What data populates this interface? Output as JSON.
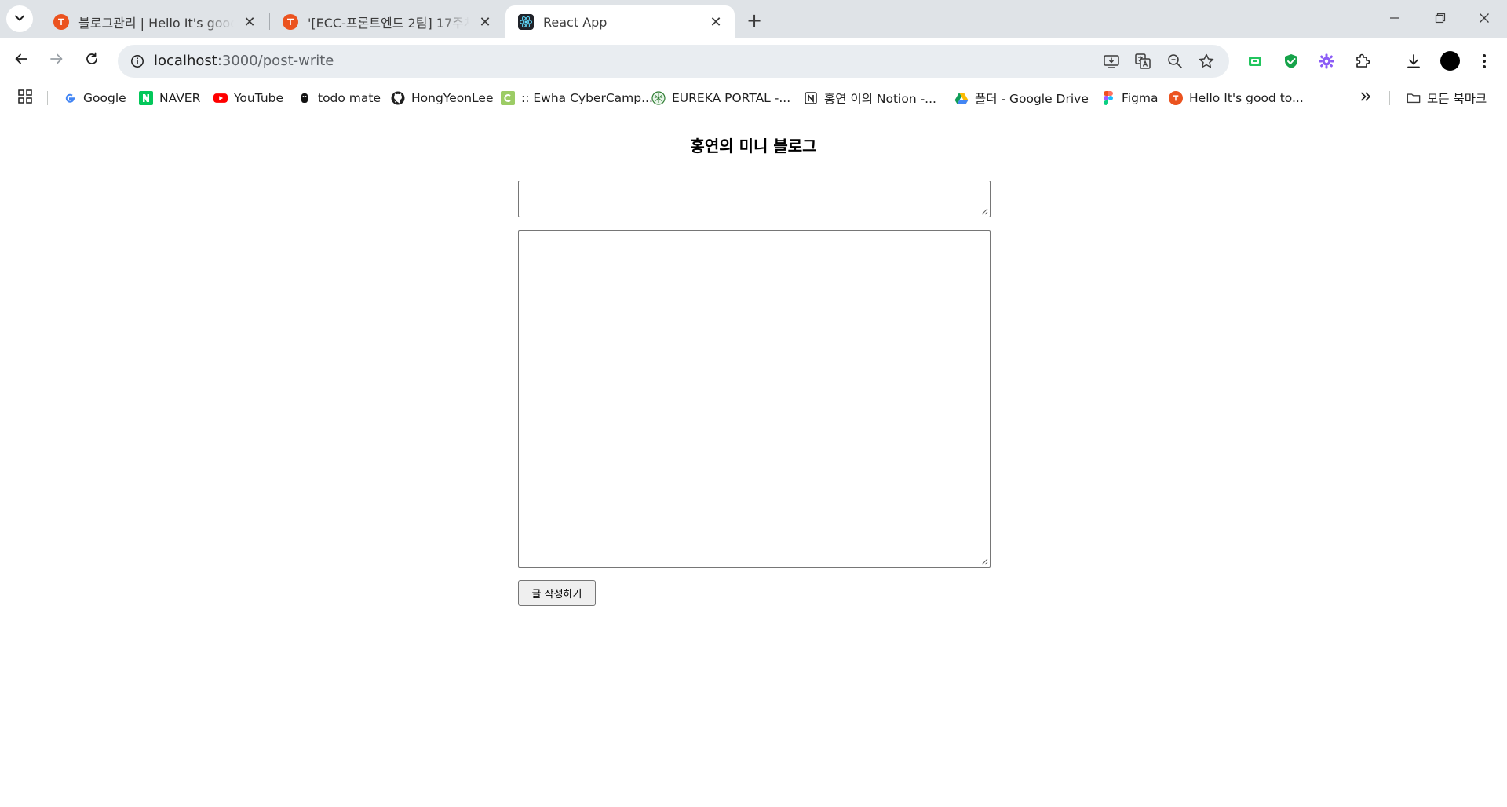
{
  "browser": {
    "tabs": [
      {
        "title": "블로그관리 | Hello It's good to",
        "favicon": "tistory-icon",
        "active": false
      },
      {
        "title": "'[ECC-프론트엔드 2팀] 17주차",
        "favicon": "tistory-icon",
        "active": false
      },
      {
        "title": "React App",
        "favicon": "react-icon",
        "active": true
      }
    ],
    "close_glyph": "✕",
    "new_tab_glyph": "+",
    "address": {
      "host": "localhost",
      "path": ":3000/post-write"
    },
    "bookmarks": [
      {
        "label": "Google",
        "icon": "google-icon"
      },
      {
        "label": "NAVER",
        "icon": "naver-icon"
      },
      {
        "label": "YouTube",
        "icon": "youtube-icon"
      },
      {
        "label": "todo mate",
        "icon": "todomate-icon"
      },
      {
        "label": "HongYeonLee",
        "icon": "github-icon"
      },
      {
        "label": ":: Ewha CyberCamp...",
        "icon": "cybercampus-icon"
      },
      {
        "label": "EUREKA PORTAL -...",
        "icon": "eureka-icon"
      },
      {
        "label": "홍연 이의 Notion -...",
        "icon": "notion-icon"
      },
      {
        "label": "폴더 - Google Drive",
        "icon": "google-drive-icon"
      },
      {
        "label": "Figma",
        "icon": "figma-icon"
      },
      {
        "label": "Hello It's good to...",
        "icon": "tistory-icon"
      }
    ],
    "all_bookmarks_label": "모든 북마크",
    "colors": {
      "tab_strip": "#dfe3e7",
      "omnibox": "#e9edf1",
      "tistory": "#eb531f",
      "react": "#61dafb"
    }
  },
  "page": {
    "title": "홍연의 미니 블로그",
    "title_input_value": "",
    "content_input_value": "",
    "submit_label": "글 작성하기"
  }
}
